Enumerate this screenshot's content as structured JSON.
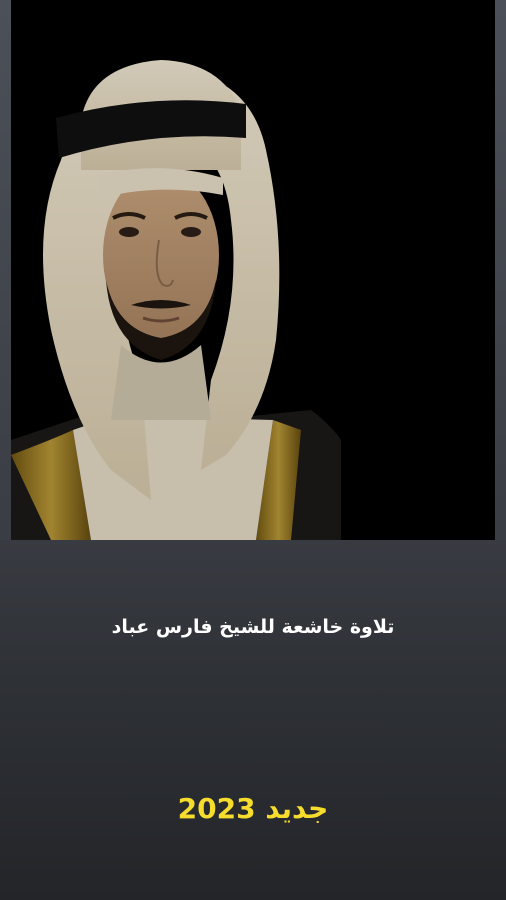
{
  "app": {
    "photo": {
      "subject": "sheikh-portrait",
      "background_color": "#000000"
    },
    "title": "تلاوة خاشعة للشيخ فارس عباد",
    "new_label": "جديد 2023",
    "colors": {
      "title_text": "#ffffff",
      "accent_yellow": "#f6dc2c",
      "panel_dark": "#2e3136"
    }
  }
}
